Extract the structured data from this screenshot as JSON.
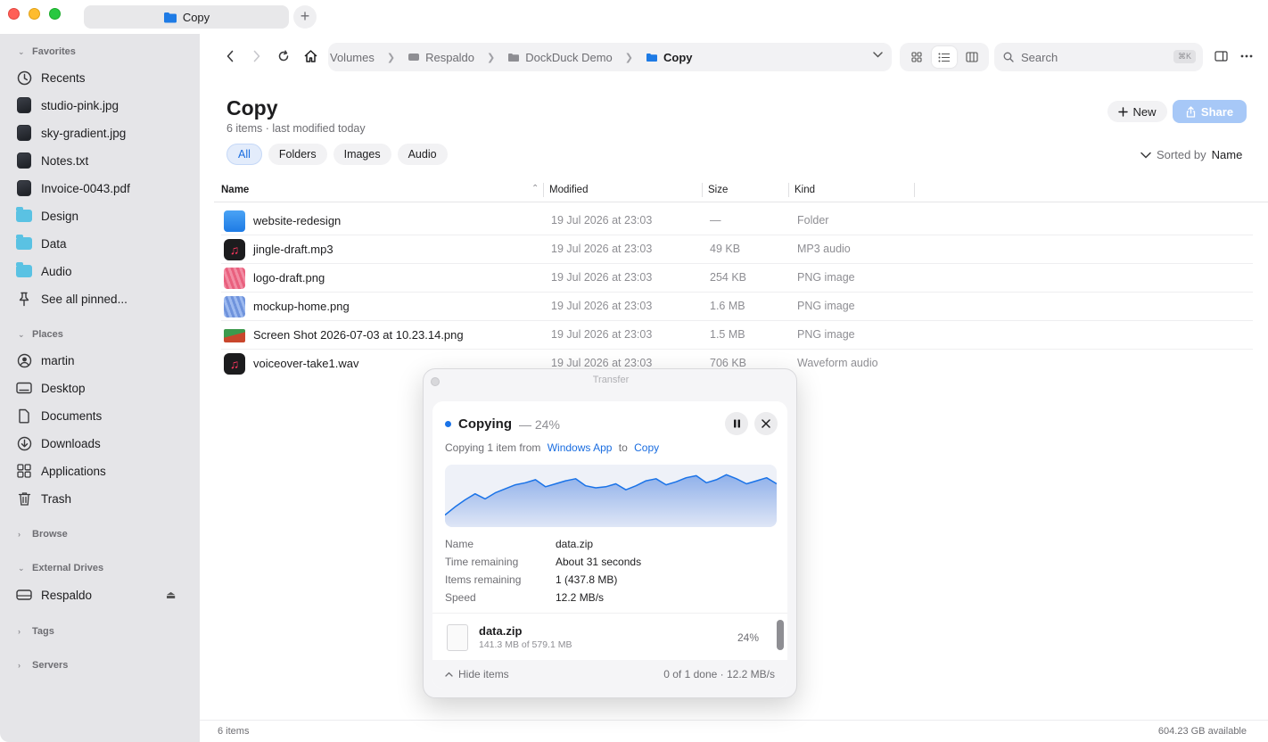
{
  "window": {
    "tab_title": "Copy",
    "new_tab_label": "+"
  },
  "sidebar": {
    "favorites_title": "Favorites",
    "favorites": [
      {
        "label": "Recents",
        "icon": "clock-icon"
      },
      {
        "label": "studio-pink.jpg",
        "icon": "image-thumbnail-icon"
      },
      {
        "label": "sky-gradient.jpg",
        "icon": "image-thumbnail-icon"
      },
      {
        "label": "Notes.txt",
        "icon": "document-thumbnail-icon"
      },
      {
        "label": "Invoice-0043.pdf",
        "icon": "document-thumbnail-icon"
      },
      {
        "label": "Design",
        "icon": "folder-icon"
      },
      {
        "label": "Data",
        "icon": "folder-icon"
      },
      {
        "label": "Audio",
        "icon": "folder-icon"
      },
      {
        "label": "See all pinned...",
        "icon": "pin-icon"
      }
    ],
    "places_title": "Places",
    "places": [
      {
        "label": "martin",
        "icon": "user-icon"
      },
      {
        "label": "Desktop",
        "icon": "desktop-icon"
      },
      {
        "label": "Documents",
        "icon": "document-icon"
      },
      {
        "label": "Downloads",
        "icon": "download-icon"
      },
      {
        "label": "Applications",
        "icon": "applications-icon"
      },
      {
        "label": "Trash",
        "icon": "trash-icon"
      }
    ],
    "browse_title": "Browse",
    "external_title": "External Drives",
    "external": [
      {
        "label": "Respaldo",
        "icon": "drive-icon"
      }
    ],
    "tags_title": "Tags",
    "servers_title": "Servers"
  },
  "toolbar": {
    "breadcrumbs": [
      "Volumes",
      "Respaldo",
      "DockDuck Demo",
      "Copy"
    ],
    "search_placeholder": "Search",
    "search_shortcut": "⌘K"
  },
  "header": {
    "title": "Copy",
    "subtitle": "6 items · last modified today",
    "filters": [
      "All",
      "Folders",
      "Images",
      "Audio"
    ],
    "active_filter": "All",
    "new_label": "New",
    "share_label": "Share",
    "sorted_prefix": "Sorted by",
    "sorted_value": "Name"
  },
  "table": {
    "columns": [
      "Name",
      "Modified",
      "Size",
      "Kind"
    ],
    "rows": [
      {
        "name": "website-redesign",
        "modified": "19 Jul 2026 at 23:03",
        "size": "—",
        "kind": "Folder",
        "icon": "folder-icon"
      },
      {
        "name": "jingle-draft.mp3",
        "modified": "19 Jul 2026 at 23:03",
        "size": "49 KB",
        "kind": "MP3 audio",
        "icon": "music-file-icon"
      },
      {
        "name": "logo-draft.png",
        "modified": "19 Jul 2026 at 23:03",
        "size": "254 KB",
        "kind": "PNG image",
        "icon": "image-file-icon"
      },
      {
        "name": "mockup-home.png",
        "modified": "19 Jul 2026 at 23:03",
        "size": "1.6 MB",
        "kind": "PNG image",
        "icon": "image-file-icon"
      },
      {
        "name": "Screen Shot 2026-07-03 at 10.23.14.png",
        "modified": "19 Jul 2026 at 23:03",
        "size": "1.5 MB",
        "kind": "PNG image",
        "icon": "image-file-icon"
      },
      {
        "name": "voiceover-take1.wav",
        "modified": "19 Jul 2026 at 23:03",
        "size": "706 KB",
        "kind": "Waveform audio",
        "icon": "music-file-icon"
      }
    ]
  },
  "status": {
    "items": "6 items",
    "available": "604.23 GB available"
  },
  "transfer": {
    "window_title": "Transfer",
    "state": "Copying",
    "percent_text": "— 24%",
    "progress": 0.24,
    "from_prefix": "Copying 1 item from",
    "from": "Windows App",
    "to_word": "to",
    "to": "Copy",
    "speed_history": [
      12,
      20,
      27,
      33,
      28,
      34,
      38,
      42,
      44,
      47,
      40,
      43,
      46,
      48,
      41,
      39,
      40,
      43,
      37,
      41,
      46,
      48,
      42,
      45,
      49,
      51,
      44,
      47,
      52,
      48,
      43,
      46,
      49,
      43
    ],
    "details": [
      {
        "label": "Name",
        "value": "data.zip"
      },
      {
        "label": "Time remaining",
        "value": "About 31 seconds"
      },
      {
        "label": "Items remaining",
        "value": "1 (437.8 MB)"
      },
      {
        "label": "Speed",
        "value": "12.2 MB/s"
      }
    ],
    "file": {
      "name": "data.zip",
      "size": "141.3 MB of 579.1 MB",
      "percent": "24%"
    },
    "hide_label": "Hide items",
    "summary": "0 of 1 done · 12.2 MB/s"
  },
  "colors": {
    "accent": "#1a73e8",
    "sidebar_bg": "#e5e5e8",
    "close": "#ff5f57",
    "minimize": "#febc2e",
    "zoom": "#28c840"
  }
}
